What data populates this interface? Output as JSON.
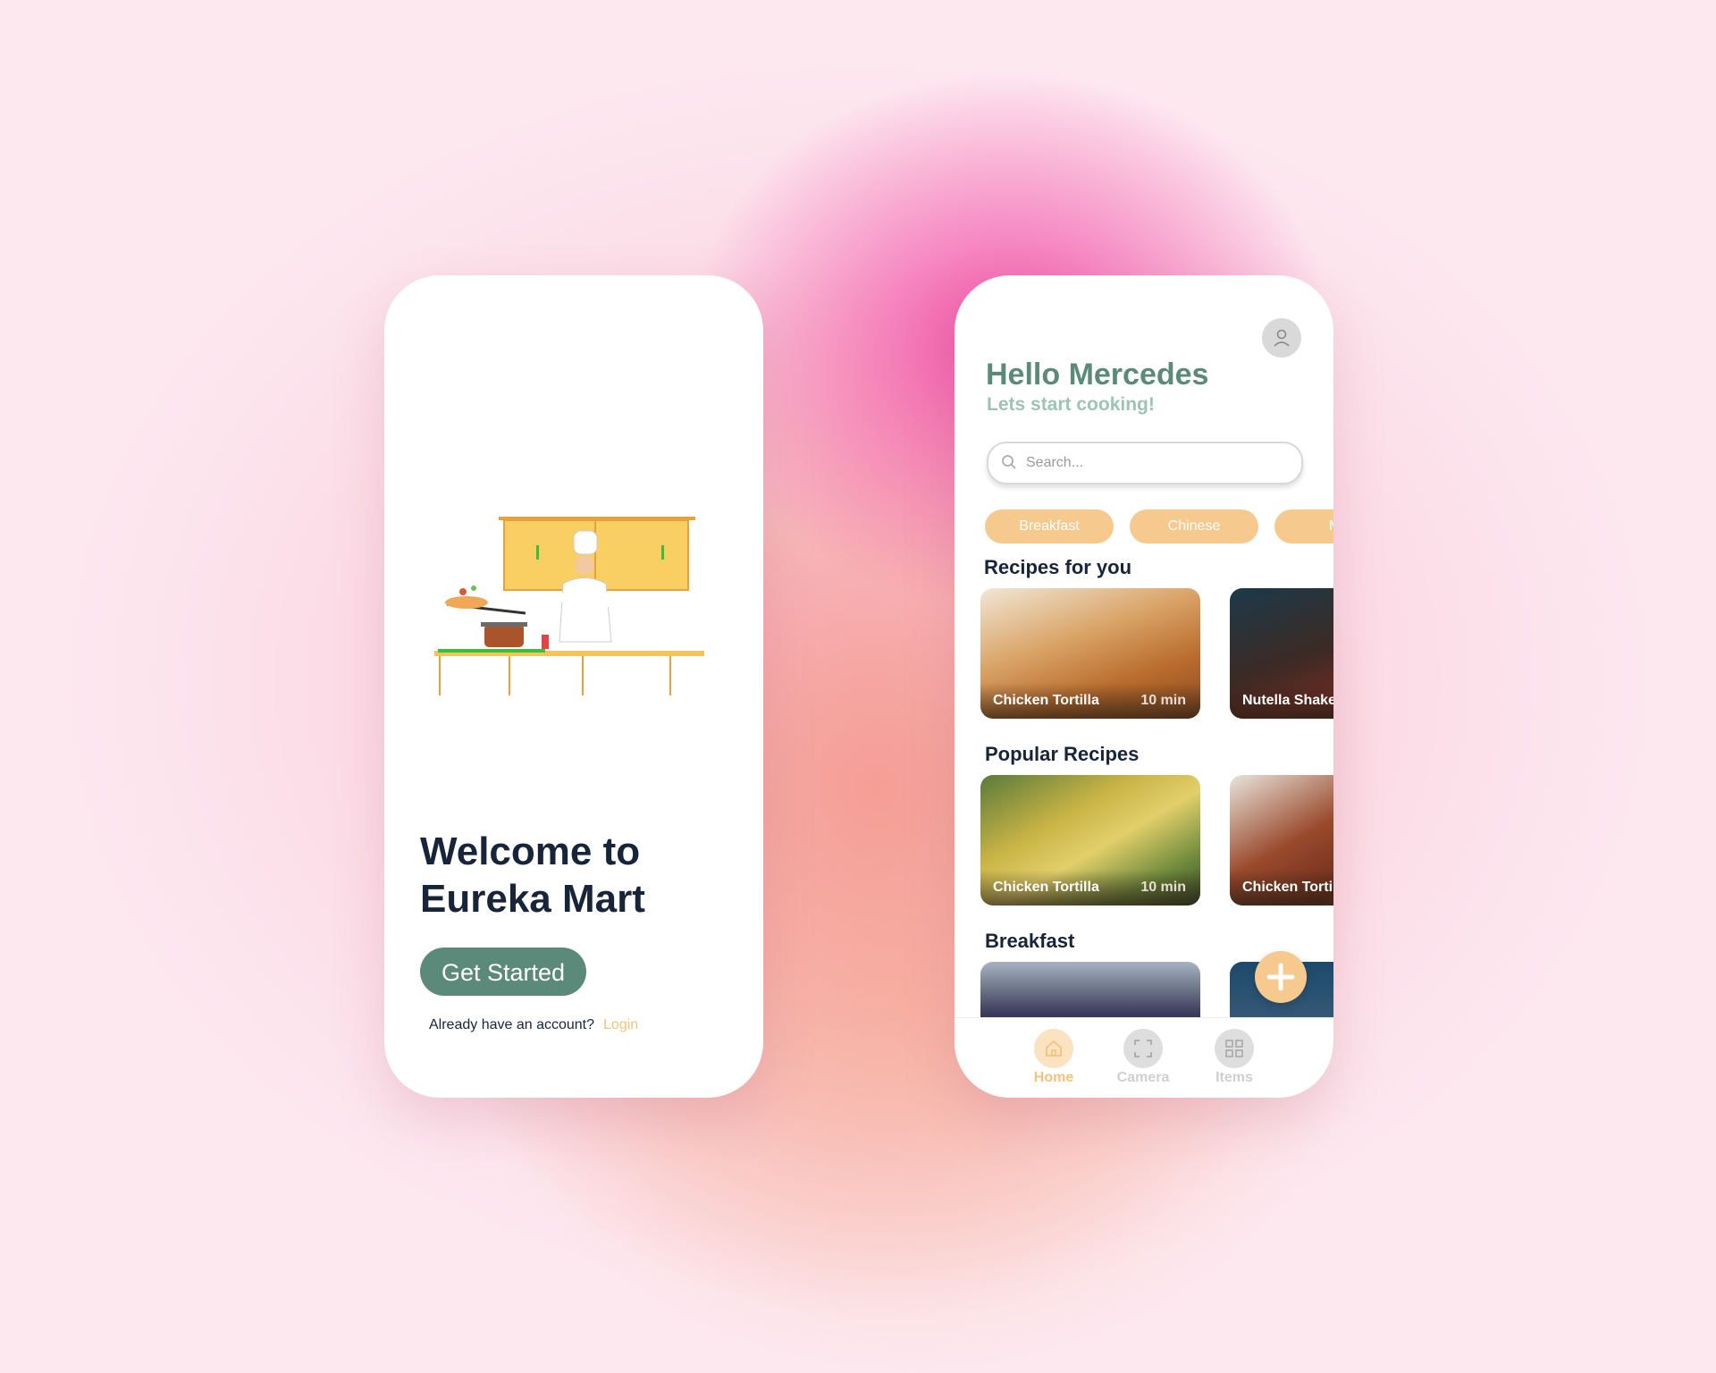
{
  "welcome_screen": {
    "title": "Welcome to Eureka Mart",
    "cta_label": "Get Started",
    "account_prompt": "Already have an account?",
    "login_label": "Login"
  },
  "home_screen": {
    "greeting": "Hello Mercedes",
    "subtitle": "Lets start cooking!",
    "search_placeholder": "Search...",
    "categories": [
      "Breakfast",
      "Chinese",
      "Me"
    ],
    "sections": {
      "recipes_for_you": {
        "title": "Recipes for you",
        "cards": [
          {
            "name": "Chicken Tortilla",
            "time": "10 min"
          },
          {
            "name": "Nutella Shake",
            "time": ""
          }
        ]
      },
      "popular_recipes": {
        "title": "Popular Recipes",
        "cards": [
          {
            "name": "Chicken Tortilla",
            "time": "10 min"
          },
          {
            "name": "Chicken Tortilla",
            "time": ""
          }
        ]
      },
      "breakfast": {
        "title": "Breakfast"
      }
    },
    "nav": [
      {
        "label": "Home",
        "icon": "home-icon",
        "active": true
      },
      {
        "label": "Camera",
        "icon": "camera-icon",
        "active": false
      },
      {
        "label": "Items",
        "icon": "grid-icon",
        "active": false
      }
    ]
  },
  "colors": {
    "brand_green": "#5b8a7b",
    "accent_orange": "#f6c98e",
    "text_dark": "#17243a"
  }
}
